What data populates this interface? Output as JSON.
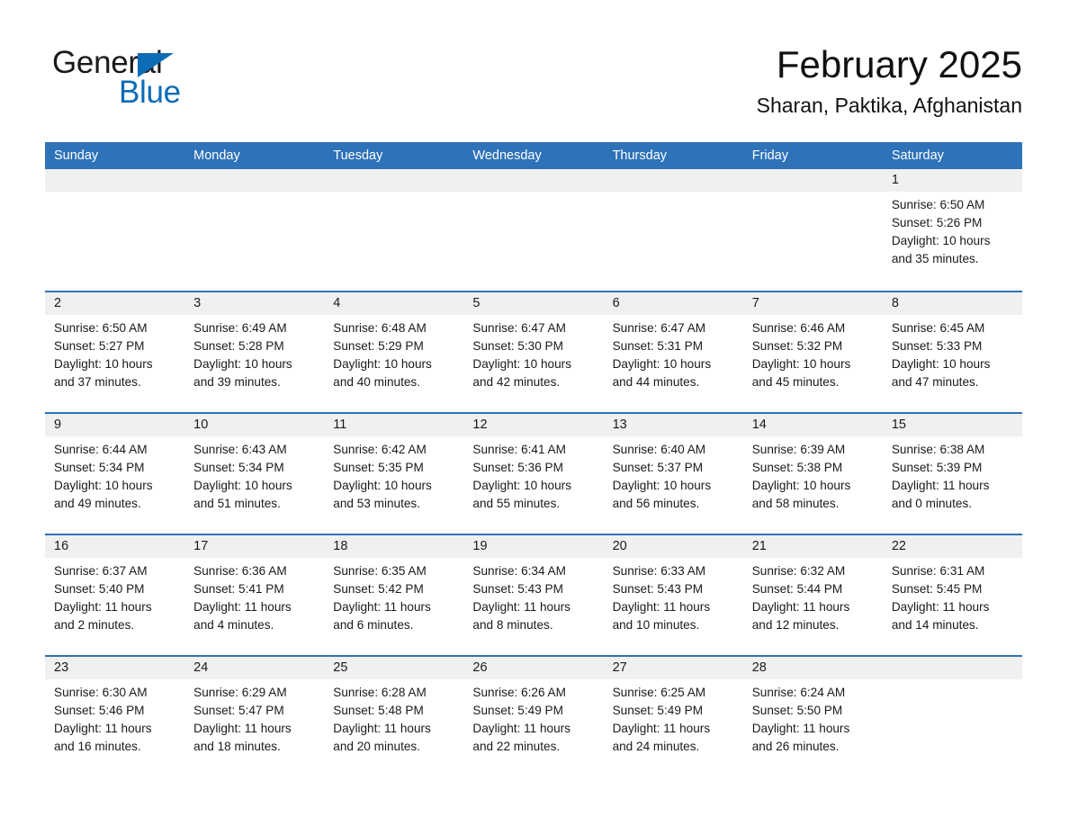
{
  "brand": {
    "name_part1": "General",
    "name_part2": "Blue",
    "accent_color": "#0b6cb8"
  },
  "header": {
    "month_title": "February 2025",
    "location": "Sharan, Paktika, Afghanistan",
    "header_bar_color": "#2e72b8",
    "day_strip_color": "#f0f0f0"
  },
  "weekdays": [
    "Sunday",
    "Monday",
    "Tuesday",
    "Wednesday",
    "Thursday",
    "Friday",
    "Saturday"
  ],
  "weeks": [
    [
      {
        "day": "",
        "lines": []
      },
      {
        "day": "",
        "lines": []
      },
      {
        "day": "",
        "lines": []
      },
      {
        "day": "",
        "lines": []
      },
      {
        "day": "",
        "lines": []
      },
      {
        "day": "",
        "lines": []
      },
      {
        "day": "1",
        "lines": [
          "Sunrise: 6:50 AM",
          "Sunset: 5:26 PM",
          "Daylight: 10 hours",
          "and 35 minutes."
        ]
      }
    ],
    [
      {
        "day": "2",
        "lines": [
          "Sunrise: 6:50 AM",
          "Sunset: 5:27 PM",
          "Daylight: 10 hours",
          "and 37 minutes."
        ]
      },
      {
        "day": "3",
        "lines": [
          "Sunrise: 6:49 AM",
          "Sunset: 5:28 PM",
          "Daylight: 10 hours",
          "and 39 minutes."
        ]
      },
      {
        "day": "4",
        "lines": [
          "Sunrise: 6:48 AM",
          "Sunset: 5:29 PM",
          "Daylight: 10 hours",
          "and 40 minutes."
        ]
      },
      {
        "day": "5",
        "lines": [
          "Sunrise: 6:47 AM",
          "Sunset: 5:30 PM",
          "Daylight: 10 hours",
          "and 42 minutes."
        ]
      },
      {
        "day": "6",
        "lines": [
          "Sunrise: 6:47 AM",
          "Sunset: 5:31 PM",
          "Daylight: 10 hours",
          "and 44 minutes."
        ]
      },
      {
        "day": "7",
        "lines": [
          "Sunrise: 6:46 AM",
          "Sunset: 5:32 PM",
          "Daylight: 10 hours",
          "and 45 minutes."
        ]
      },
      {
        "day": "8",
        "lines": [
          "Sunrise: 6:45 AM",
          "Sunset: 5:33 PM",
          "Daylight: 10 hours",
          "and 47 minutes."
        ]
      }
    ],
    [
      {
        "day": "9",
        "lines": [
          "Sunrise: 6:44 AM",
          "Sunset: 5:34 PM",
          "Daylight: 10 hours",
          "and 49 minutes."
        ]
      },
      {
        "day": "10",
        "lines": [
          "Sunrise: 6:43 AM",
          "Sunset: 5:34 PM",
          "Daylight: 10 hours",
          "and 51 minutes."
        ]
      },
      {
        "day": "11",
        "lines": [
          "Sunrise: 6:42 AM",
          "Sunset: 5:35 PM",
          "Daylight: 10 hours",
          "and 53 minutes."
        ]
      },
      {
        "day": "12",
        "lines": [
          "Sunrise: 6:41 AM",
          "Sunset: 5:36 PM",
          "Daylight: 10 hours",
          "and 55 minutes."
        ]
      },
      {
        "day": "13",
        "lines": [
          "Sunrise: 6:40 AM",
          "Sunset: 5:37 PM",
          "Daylight: 10 hours",
          "and 56 minutes."
        ]
      },
      {
        "day": "14",
        "lines": [
          "Sunrise: 6:39 AM",
          "Sunset: 5:38 PM",
          "Daylight: 10 hours",
          "and 58 minutes."
        ]
      },
      {
        "day": "15",
        "lines": [
          "Sunrise: 6:38 AM",
          "Sunset: 5:39 PM",
          "Daylight: 11 hours",
          "and 0 minutes."
        ]
      }
    ],
    [
      {
        "day": "16",
        "lines": [
          "Sunrise: 6:37 AM",
          "Sunset: 5:40 PM",
          "Daylight: 11 hours",
          "and 2 minutes."
        ]
      },
      {
        "day": "17",
        "lines": [
          "Sunrise: 6:36 AM",
          "Sunset: 5:41 PM",
          "Daylight: 11 hours",
          "and 4 minutes."
        ]
      },
      {
        "day": "18",
        "lines": [
          "Sunrise: 6:35 AM",
          "Sunset: 5:42 PM",
          "Daylight: 11 hours",
          "and 6 minutes."
        ]
      },
      {
        "day": "19",
        "lines": [
          "Sunrise: 6:34 AM",
          "Sunset: 5:43 PM",
          "Daylight: 11 hours",
          "and 8 minutes."
        ]
      },
      {
        "day": "20",
        "lines": [
          "Sunrise: 6:33 AM",
          "Sunset: 5:43 PM",
          "Daylight: 11 hours",
          "and 10 minutes."
        ]
      },
      {
        "day": "21",
        "lines": [
          "Sunrise: 6:32 AM",
          "Sunset: 5:44 PM",
          "Daylight: 11 hours",
          "and 12 minutes."
        ]
      },
      {
        "day": "22",
        "lines": [
          "Sunrise: 6:31 AM",
          "Sunset: 5:45 PM",
          "Daylight: 11 hours",
          "and 14 minutes."
        ]
      }
    ],
    [
      {
        "day": "23",
        "lines": [
          "Sunrise: 6:30 AM",
          "Sunset: 5:46 PM",
          "Daylight: 11 hours",
          "and 16 minutes."
        ]
      },
      {
        "day": "24",
        "lines": [
          "Sunrise: 6:29 AM",
          "Sunset: 5:47 PM",
          "Daylight: 11 hours",
          "and 18 minutes."
        ]
      },
      {
        "day": "25",
        "lines": [
          "Sunrise: 6:28 AM",
          "Sunset: 5:48 PM",
          "Daylight: 11 hours",
          "and 20 minutes."
        ]
      },
      {
        "day": "26",
        "lines": [
          "Sunrise: 6:26 AM",
          "Sunset: 5:49 PM",
          "Daylight: 11 hours",
          "and 22 minutes."
        ]
      },
      {
        "day": "27",
        "lines": [
          "Sunrise: 6:25 AM",
          "Sunset: 5:49 PM",
          "Daylight: 11 hours",
          "and 24 minutes."
        ]
      },
      {
        "day": "28",
        "lines": [
          "Sunrise: 6:24 AM",
          "Sunset: 5:50 PM",
          "Daylight: 11 hours",
          "and 26 minutes."
        ]
      },
      {
        "day": "",
        "lines": []
      }
    ]
  ]
}
